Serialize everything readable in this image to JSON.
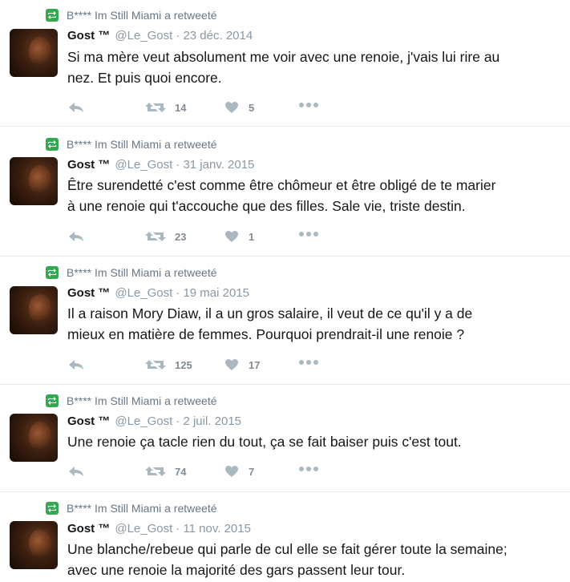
{
  "retweet_label": "B**** Im Still Miami a retweeté",
  "author": {
    "name": "Gost ™",
    "handle": "@Le_Gost"
  },
  "icons": {
    "retweet_badge": "retweet-icon",
    "reply": "reply-icon",
    "retweet": "retweet-icon",
    "like": "heart-icon",
    "more": "more-icon"
  },
  "colors": {
    "retweet_green": "#35a853",
    "icon_gray": "#aab8c2",
    "meta_gray": "#8899a6"
  },
  "tweets": [
    {
      "date": "· 23 déc. 2014",
      "lines": [
        "Si ma mère veut absolument me voir avec une renoie, j'vais lui rire au",
        "nez. Et puis quoi encore."
      ],
      "retweets": "14",
      "likes": "5"
    },
    {
      "date": "· 31 janv. 2015",
      "lines": [
        "Être surendetté c'est comme être chômeur et être obligé de te marier",
        "à une renoie qui t'accouche que des filles. Sale vie, triste destin."
      ],
      "retweets": "23",
      "likes": "1"
    },
    {
      "date": "· 19 mai 2015",
      "lines": [
        "Il a raison Mory Diaw, il a un gros salaire, il veut de ce qu'il y a de",
        "mieux en matière de femmes. Pourquoi prendrait-il une renoie ?"
      ],
      "retweets": "125",
      "likes": "17"
    },
    {
      "date": "· 2 juil. 2015",
      "lines": [
        "Une renoie ça tacle rien du tout, ça se fait baiser puis c'est tout."
      ],
      "retweets": "74",
      "likes": "7"
    },
    {
      "date": "· 11 nov. 2015",
      "lines": [
        "Une blanche/rebeue qui parle de cul elle se fait gérer toute la semaine;",
        "avec une renoie la majorité des gars passent leur tour."
      ],
      "retweets": "",
      "likes": ""
    }
  ]
}
